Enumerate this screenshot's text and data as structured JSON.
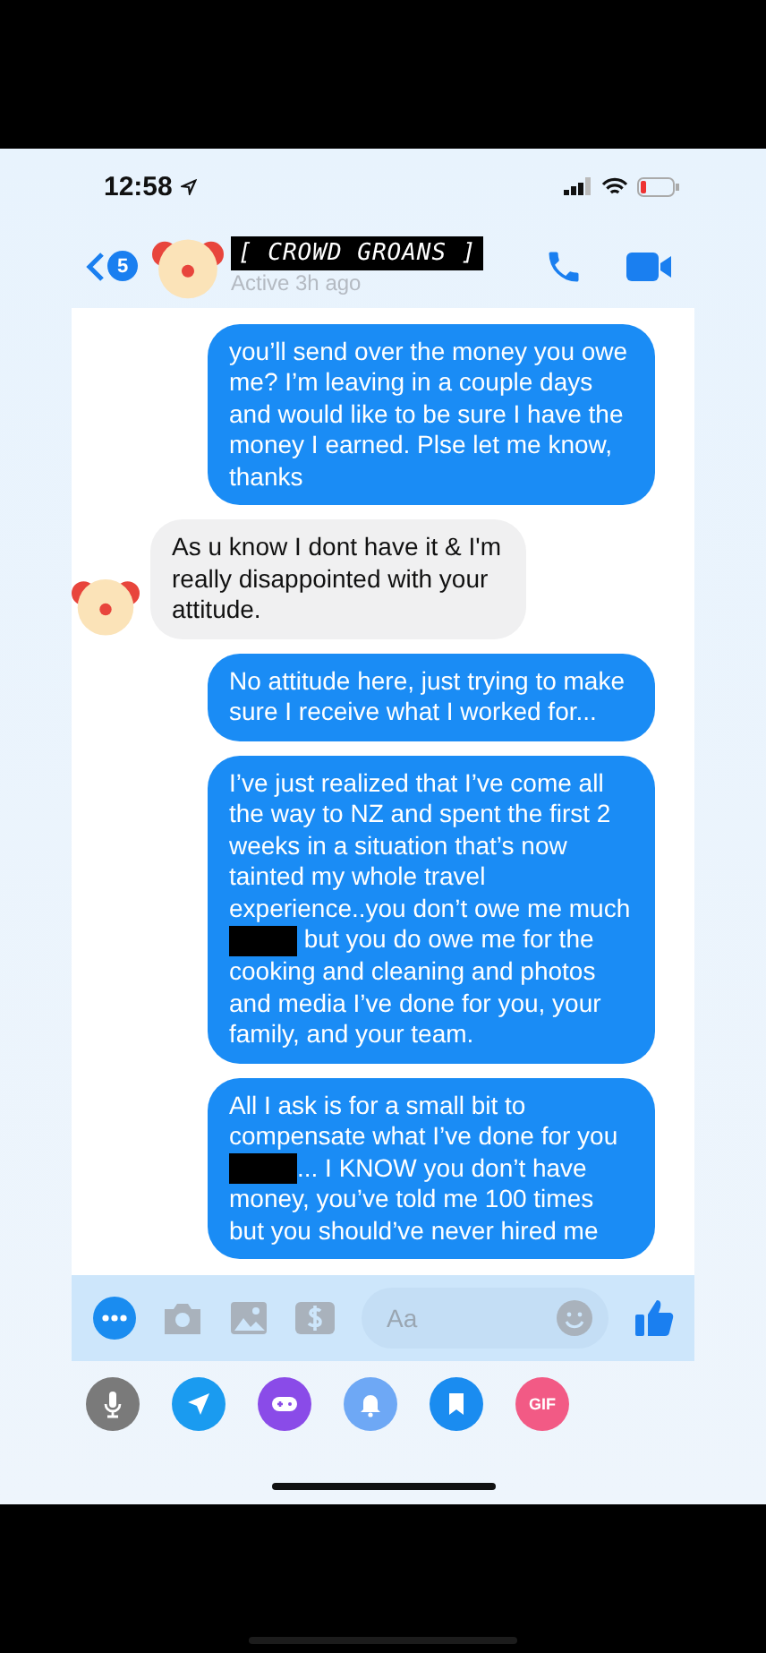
{
  "status_bar": {
    "time": "12:58"
  },
  "header": {
    "back_badge": "5",
    "title": "[ CROWD GROANS ]",
    "subtitle": "Active 3h ago"
  },
  "messages": [
    {
      "outgoing": true,
      "segments": [
        {
          "kind": "text",
          "text": "you’ll send over the money you owe me? I’m leaving in a couple days and would like to be sure I have the money I earned. Plse let me know, thanks"
        }
      ]
    },
    {
      "outgoing": false,
      "segments": [
        {
          "kind": "text",
          "text": "As u know I dont have it & I'm really disappointed with your attitude."
        }
      ]
    },
    {
      "outgoing": true,
      "segments": [
        {
          "kind": "text",
          "text": "No attitude here, just trying to make sure I receive what I worked for..."
        }
      ]
    },
    {
      "outgoing": true,
      "segments": [
        {
          "kind": "text",
          "text": "I’ve just realized that I’ve come all the way to NZ and spent the first 2 weeks in a situation that’s now tainted my whole travel experience..you don’t owe me much "
        },
        {
          "kind": "redaction"
        },
        {
          "kind": "text",
          "text": "  but you do owe me for the cooking and cleaning and photos and media I’ve done for you, your family, and your team."
        }
      ]
    },
    {
      "outgoing": true,
      "segments": [
        {
          "kind": "text",
          "text": "All I ask is for a small bit to compensate what I’ve done for you "
        },
        {
          "kind": "redaction"
        },
        {
          "kind": "text",
          "text": "... I KNOW you don’t have money, you’ve told me 100 times but you should’ve never hired me"
        }
      ]
    }
  ],
  "composer": {
    "placeholder": "Aa"
  },
  "app_row": [
    {
      "kind": "mic",
      "color": "#7a7a7a"
    },
    {
      "kind": "send",
      "color": "#1a9bf0"
    },
    {
      "kind": "game",
      "color": "#8a4be8"
    },
    {
      "kind": "bell",
      "color": "#6ea8f5"
    },
    {
      "kind": "bookmark",
      "color": "#1a8cf0"
    },
    {
      "kind": "gif",
      "color": "#f25a85",
      "label": "GIF"
    }
  ]
}
